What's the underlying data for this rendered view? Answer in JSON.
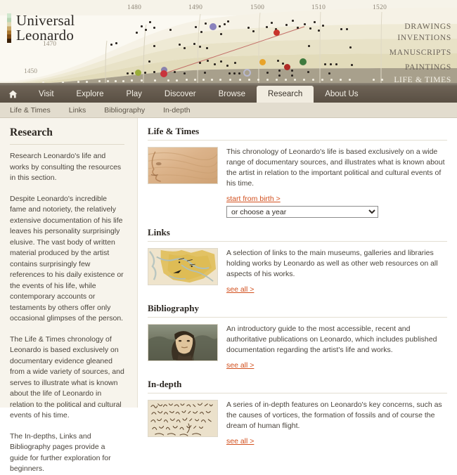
{
  "site": {
    "logo_line1": "Universal",
    "logo_line2": "Leonardo"
  },
  "banner": {
    "year_ticks": [
      "1480",
      "1490",
      "1500",
      "1510",
      "1520"
    ],
    "curve_years": [
      "1470",
      "1450"
    ],
    "band_labels": [
      "DRAWINGS",
      "INVENTIONS",
      "MANUSCRIPTS",
      "PAINTINGS",
      "LIFE & TIMES"
    ]
  },
  "nav": {
    "home_icon": "home-icon",
    "items": [
      {
        "label": "Visit",
        "active": false
      },
      {
        "label": "Explore",
        "active": false
      },
      {
        "label": "Play",
        "active": false
      },
      {
        "label": "Discover",
        "active": false
      },
      {
        "label": "Browse",
        "active": false
      },
      {
        "label": "Research",
        "active": true
      },
      {
        "label": "About Us",
        "active": false
      }
    ]
  },
  "subnav": {
    "items": [
      "Life & Times",
      "Links",
      "Bibliography",
      "In-depth"
    ]
  },
  "sidebar": {
    "title": "Research",
    "paragraphs": [
      "Research Leonardo's life and works by consulting the resources in this section.",
      "Despite Leonardo's incredible fame and notoriety, the relatively extensive documentation of his life leaves his personality surprisingly elusive. The vast body of written material produced by the artist contains surprisingly few references to his daily existence or the events of his life, while contemporary accounts or testaments by others offer only occasional glimpses of the person.",
      "The Life & Times chronology of Leonardo is based exclusively on documentary evidence gleaned from a wide variety of sources, and serves to illustrate what is known about the life of Leonardo in relation to the political and cultural events of his time.",
      "The In-depths, Links and Bibliography pages provide a guide for further exploration for beginners."
    ]
  },
  "sections": [
    {
      "id": "life-and-times",
      "heading": "Life & Times",
      "thumb_name": "leonardo-face-thumbnail",
      "description": "This chronology of Leonardo's life is based exclusively on a wide range of documentary sources, and illustrates what is known about the artist in relation to the important political and cultural events of his time.",
      "start_link": "start from birth >",
      "select_value": "or choose a year",
      "see_all": null
    },
    {
      "id": "links",
      "heading": "Links",
      "thumb_name": "old-map-thumbnail",
      "description": "A selection of links to the main museums, galleries and libraries holding works by Leonardo as well as other web resources on all aspects of his works.",
      "start_link": null,
      "select_value": null,
      "see_all": "see all >"
    },
    {
      "id": "bibliography",
      "heading": "Bibliography",
      "thumb_name": "mona-lisa-thumbnail",
      "description": "An introductory guide to the most accessible, recent and authoritative publications on Leonardo, which includes published documentation regarding the artist's life and works.",
      "start_link": null,
      "select_value": null,
      "see_all": "see all >"
    },
    {
      "id": "in-depth",
      "heading": "In-depth",
      "thumb_name": "manuscript-mirror-writing-thumbnail",
      "description": "A series of in-depth features on Leonardo's key concerns, such as the causes of vortices, the formation of fossils and of course the dream of human flight.",
      "start_link": null,
      "select_value": null,
      "see_all": "see all >"
    }
  ],
  "colors": {
    "accent_link": "#d2501e",
    "nav_bar": "#594f43",
    "subnav_bar": "#e2dcce",
    "sidebar_bg": "#f7f4ec",
    "active_tab_bg": "#f1ece0"
  }
}
